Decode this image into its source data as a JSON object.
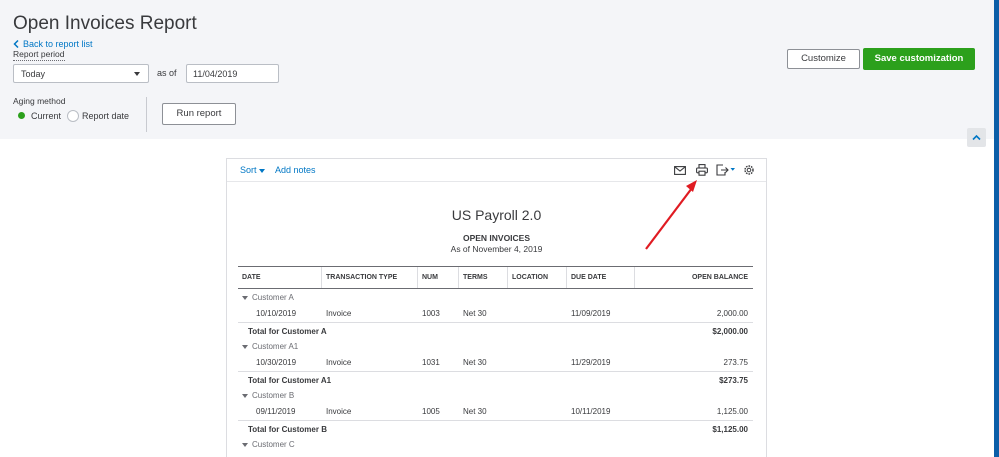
{
  "header": {
    "title": "Open Invoices Report",
    "back_link": "Back to report list",
    "report_period_label": "Report period",
    "period_value": "Today",
    "as_of_label": "as of",
    "as_of_date": "11/04/2019",
    "aging_method_label": "Aging method",
    "aging_current": "Current",
    "aging_report_date": "Report date",
    "run_report": "Run report",
    "customize": "Customize",
    "save_customization": "Save customization"
  },
  "toolbar": {
    "sort": "Sort",
    "add_notes": "Add notes",
    "icons": [
      "email-icon",
      "print-icon",
      "export-icon",
      "settings-icon"
    ]
  },
  "report": {
    "company": "US Payroll 2.0",
    "name": "OPEN INVOICES",
    "as_of": "As of November 4, 2019",
    "columns": [
      "DATE",
      "TRANSACTION TYPE",
      "NUM",
      "TERMS",
      "LOCATION",
      "DUE DATE",
      "OPEN BALANCE"
    ],
    "groups": [
      {
        "customer": "Customer A",
        "rows": [
          {
            "date": "10/10/2019",
            "type": "Invoice",
            "num": "1003",
            "terms": "Net 30",
            "location": "",
            "due": "11/09/2019",
            "balance": "2,000.00"
          }
        ],
        "total_label": "Total for Customer A",
        "total": "$2,000.00"
      },
      {
        "customer": "Customer A1",
        "rows": [
          {
            "date": "10/30/2019",
            "type": "Invoice",
            "num": "1031",
            "terms": "Net 30",
            "location": "",
            "due": "11/29/2019",
            "balance": "273.75"
          }
        ],
        "total_label": "Total for Customer A1",
        "total": "$273.75"
      },
      {
        "customer": "Customer B",
        "rows": [
          {
            "date": "09/11/2019",
            "type": "Invoice",
            "num": "1005",
            "terms": "Net 30",
            "location": "",
            "due": "10/11/2019",
            "balance": "1,125.00"
          }
        ],
        "total_label": "Total for Customer B",
        "total": "$1,125.00"
      },
      {
        "customer": "Customer C",
        "rows": [],
        "total_label": "",
        "total": ""
      }
    ]
  },
  "colors": {
    "accent_green": "#2ca01c",
    "link_blue": "#0077c5",
    "annotation_red": "#e01b22",
    "panel_bg": "#f4f5f8"
  }
}
